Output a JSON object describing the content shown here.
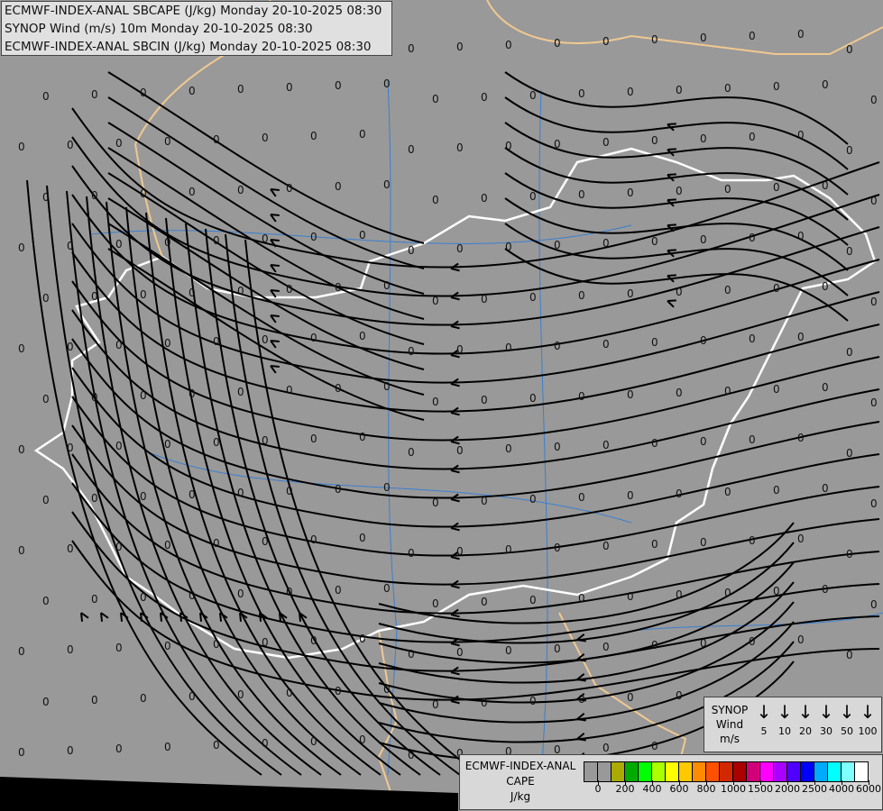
{
  "titles": [
    "ECMWF-INDEX-ANAL SBCAPE (J/kg) Monday 20-10-2025 08:30",
    "SYNOP Wind (m/s) 10m Monday 20-10-2025 08:30",
    "ECMWF-INDEX-ANAL SBCIN (J/kg) Monday 20-10-2025 08:30"
  ],
  "cin_value": "0",
  "synop_legend": {
    "l1": "SYNOP",
    "l2": "Wind",
    "l3": "m/s",
    "speeds": [
      "5",
      "10",
      "20",
      "30",
      "50",
      "100"
    ]
  },
  "cape_legend": {
    "l1": "ECMWF-INDEX-ANAL",
    "l2": "CAPE",
    "l3": "J/kg",
    "colors": [
      "#999999",
      "#999999",
      "#aaaa00",
      "#00aa00",
      "#00ff00",
      "#aaff00",
      "#ffff00",
      "#ffc800",
      "#ff8c00",
      "#ff5000",
      "#d22800",
      "#aa0000",
      "#d20078",
      "#ff00ff",
      "#aa00ff",
      "#5000ff",
      "#0000ff",
      "#00aaff",
      "#00ffff",
      "#80ffff",
      "#ffffff"
    ],
    "ticks": [
      "0",
      "200",
      "400",
      "600",
      "800",
      "1000",
      "1500",
      "2000",
      "2500",
      "4000",
      "6000"
    ]
  },
  "colors": {
    "background": "#999999",
    "border_country": "#ffffff",
    "border_other": "#f0c890",
    "rivers": "#3a7fd0",
    "streamlines": "#000000"
  }
}
